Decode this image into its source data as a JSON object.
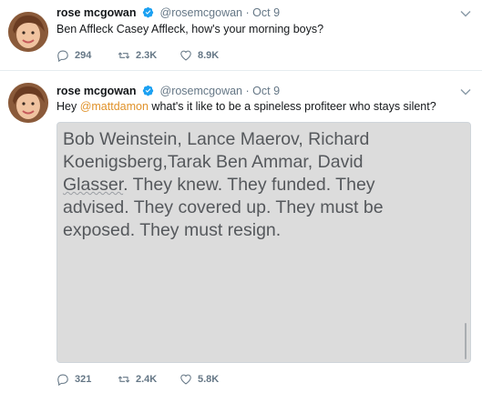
{
  "tweets": [
    {
      "name": "rose mcgowan",
      "handle": "@rosemcgowan",
      "separator": "·",
      "date": "Oct 9",
      "text": "Ben Affleck Casey Affleck, how's your morning boys?",
      "replies": "294",
      "retweets": "2.3K",
      "likes": "8.9K"
    },
    {
      "name": "rose mcgowan",
      "handle": "@rosemcgowan",
      "separator": "·",
      "date": "Oct 9",
      "text_prefix": "Hey ",
      "mention": "@mattdamon",
      "text_suffix": " what's it like to be a spineless profiteer who stays silent?",
      "media": {
        "line1": "Bob Weinstein, Lance Maerov, Richard",
        "line2": "Koenigsberg,Tarak Ben Ammar, David",
        "line3_underlined": "Glasser",
        "line3_rest": ". They knew. They funded. They",
        "line4": "advised. They covered up. They must be",
        "line5": "exposed. They must resign."
      },
      "replies": "321",
      "retweets": "2.4K",
      "likes": "5.8K"
    }
  ],
  "icons": {
    "verified": "verified-badge-icon",
    "reply": "reply-icon",
    "retweet": "retweet-icon",
    "like": "heart-icon",
    "menu": "chevron-down-icon"
  },
  "colors": {
    "verified": "#1da1f2",
    "mention": "#e0922a",
    "meta": "#657786",
    "media_bg": "#dcdcdc"
  }
}
